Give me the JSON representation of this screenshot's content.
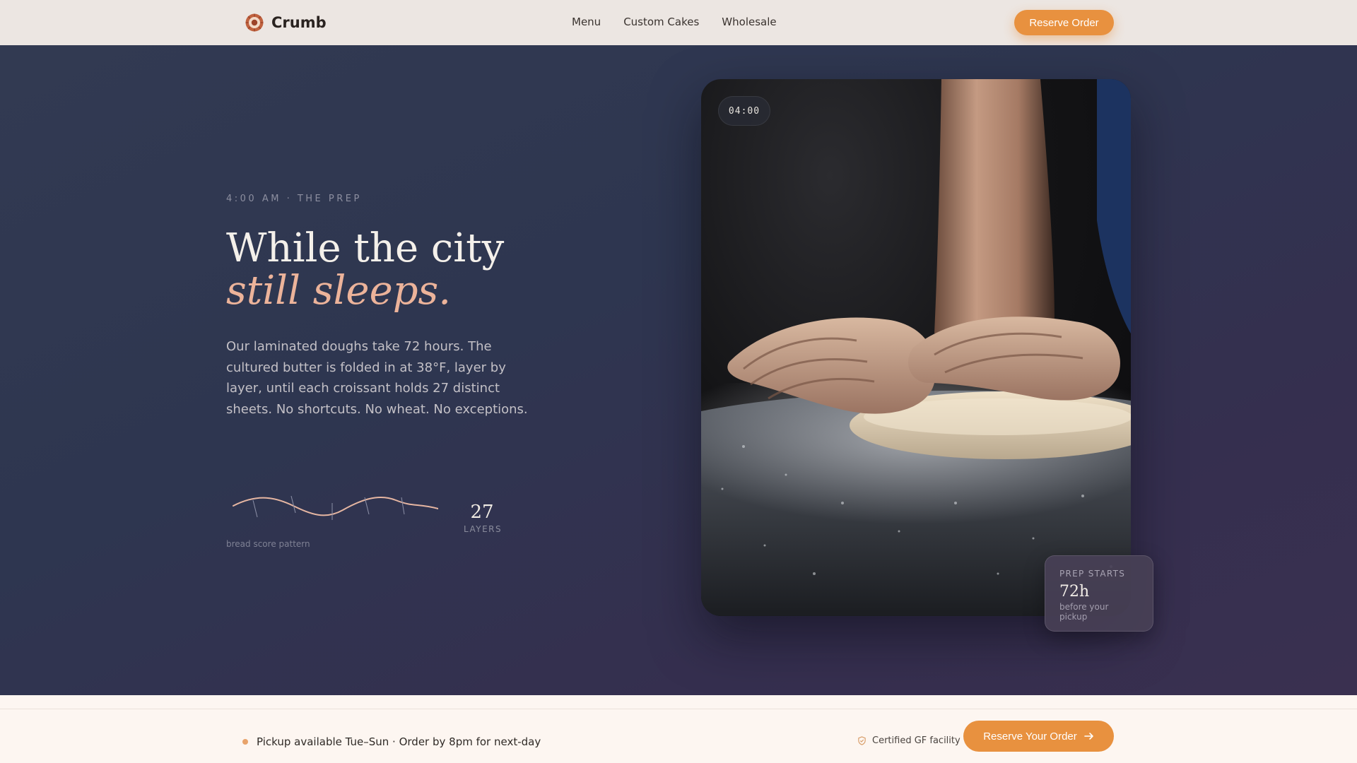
{
  "nav": {
    "brand": "Crumb",
    "links": [
      "Menu",
      "Custom Cakes",
      "Wholesale"
    ],
    "cta": "Reserve Order"
  },
  "hero": {
    "eyebrow": "4:00 AM · THE PREP",
    "headline_line1": "While the city",
    "headline_line2": "still sleeps.",
    "body": "Our laminated doughs take 72 hours. The cultured butter is folded in at 38°F, layer by layer, until each croissant holds 27 distinct sheets. No shortcuts. No wheat. No exceptions.",
    "score_caption": "bread score pattern",
    "layers_number": "27",
    "layers_label": "LAYERS"
  },
  "photo": {
    "time_badge": "04:00",
    "prep_label": "PREP STARTS",
    "prep_value": "72h",
    "prep_sub": "before your pickup"
  },
  "footer": {
    "pickup": "Pickup available Tue–Sun · Order by 8pm for next-day",
    "cert": "Certified GF facility",
    "cta": "Reserve Your Order"
  },
  "colors": {
    "accent": "#e8913f",
    "headline_italic": "#ecb39a",
    "hero_bg": "#323a52"
  },
  "icons": {
    "logo": "bread-logo-icon",
    "cert": "shield-check-icon",
    "cta_arrow": "arrow-right-icon"
  }
}
